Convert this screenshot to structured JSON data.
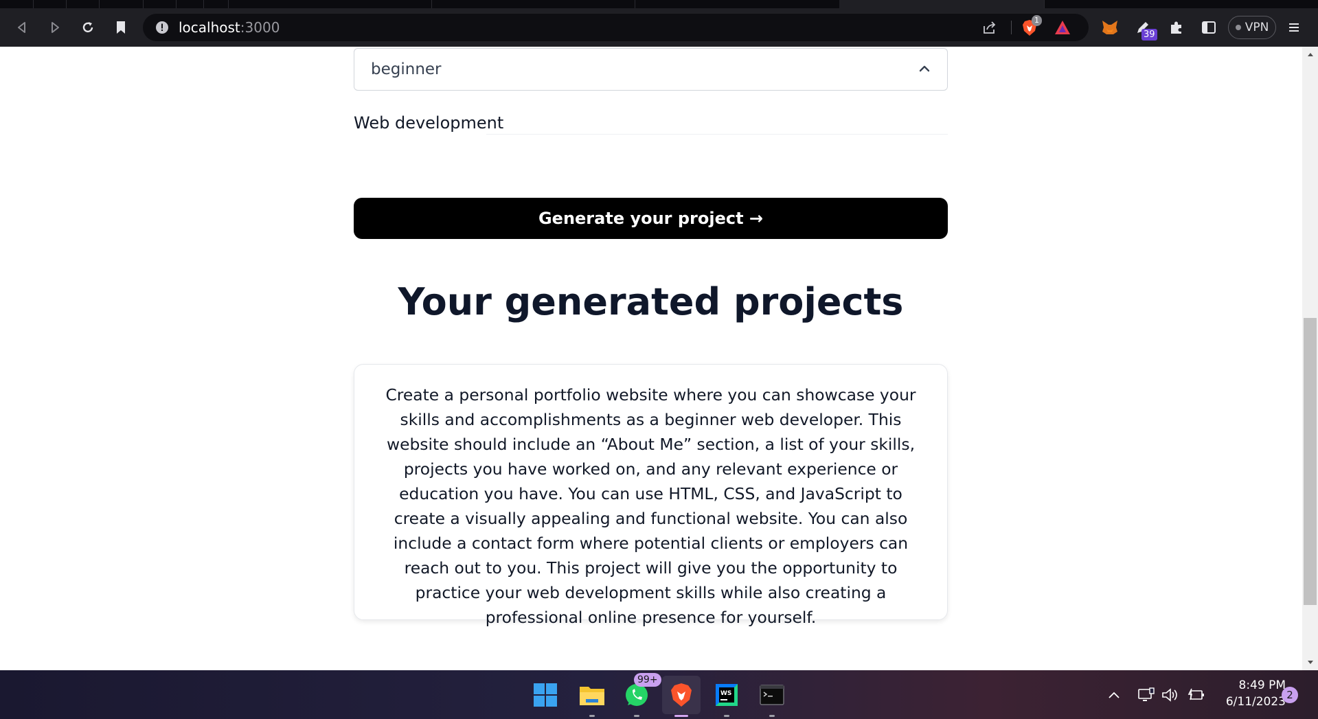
{
  "browser": {
    "url_host": "localhost",
    "url_port": ":3000",
    "extension_badge_count": "39",
    "brave_shield_count": "1",
    "vpn_label": "VPN"
  },
  "form": {
    "level_select_value": "beginner",
    "topic_text": "Web development",
    "generate_button_label": "Generate your project →"
  },
  "results": {
    "heading": "Your generated projects",
    "projects": [
      {
        "description": "Create a personal portfolio website where you can showcase your skills and accomplishments as a beginner web developer. This website should include an “About Me” section, a list of your skills, projects you have worked on, and any relevant experience or education you have. You can use HTML, CSS, and JavaScript to create a visually appealing and functional website. You can also include a contact form where potential clients or employers can reach out to you. This project will give you the opportunity to practice your web development skills while also creating a professional online presence for yourself."
      }
    ]
  },
  "taskbar": {
    "apps": [
      "start",
      "file-explorer",
      "whatsapp",
      "brave",
      "webstorm",
      "terminal"
    ],
    "whatsapp_badge": "99+",
    "time": "8:49 PM",
    "date": "6/11/2023",
    "notification_count": "2"
  },
  "colors": {
    "button_bg": "#000000",
    "heading": "#0f172a",
    "chrome_bg": "#1f1f24",
    "accent_purple": "#c9a0ef"
  }
}
